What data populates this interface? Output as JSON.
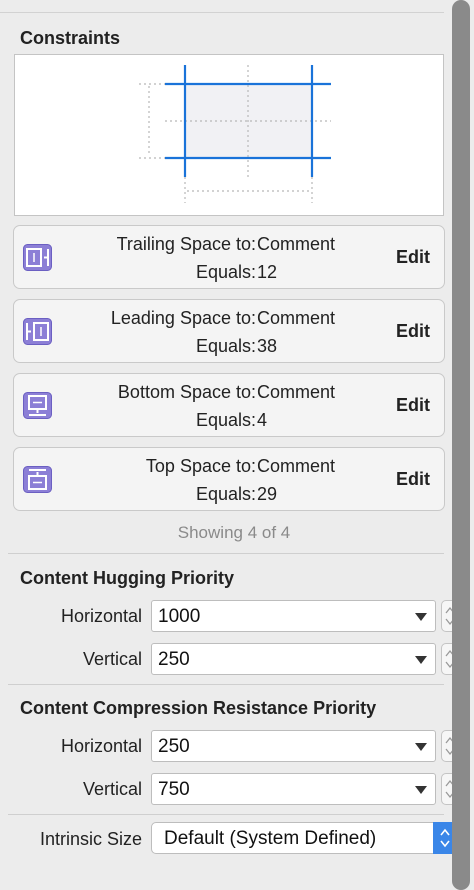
{
  "constraints": {
    "title": "Constraints",
    "items": [
      {
        "label": "Trailing Space to:",
        "target": "Comment",
        "equals_label": "Equals:",
        "value": "12",
        "edit": "Edit",
        "icon": "trailing-space-icon"
      },
      {
        "label": "Leading Space to:",
        "target": "Comment",
        "equals_label": "Equals:",
        "value": "38",
        "edit": "Edit",
        "icon": "leading-space-icon"
      },
      {
        "label": "Bottom Space to:",
        "target": "Comment",
        "equals_label": "Equals:",
        "value": "4",
        "edit": "Edit",
        "icon": "bottom-space-icon"
      },
      {
        "label": "Top Space to:",
        "target": "Comment",
        "equals_label": "Equals:",
        "value": "29",
        "edit": "Edit",
        "icon": "top-space-icon"
      }
    ],
    "showing": "Showing 4 of 4"
  },
  "hugging": {
    "title": "Content Hugging Priority",
    "horizontal_label": "Horizontal",
    "horizontal_value": "1000",
    "vertical_label": "Vertical",
    "vertical_value": "250"
  },
  "compression": {
    "title": "Content Compression Resistance Priority",
    "horizontal_label": "Horizontal",
    "horizontal_value": "250",
    "vertical_label": "Vertical",
    "vertical_value": "750"
  },
  "intrinsic": {
    "label": "Intrinsic Size",
    "value": "Default (System Defined)"
  },
  "colors": {
    "accent": "#1a73d9",
    "icon_fill": "#8c7fd6",
    "popup_button": "#3a86e8"
  }
}
